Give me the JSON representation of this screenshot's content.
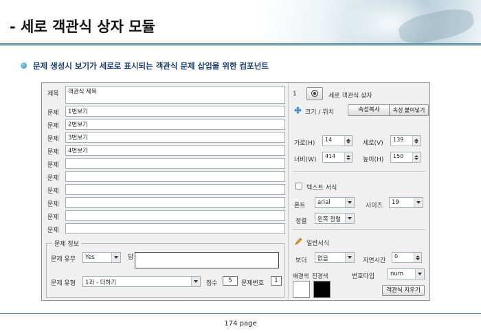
{
  "slide": {
    "title": "- 세로 객관식 상자 모듈",
    "subtitle": "문제 생성시 보기가 세로로 표시되는 객관식 문제 삽입을 위한 컴포넌트",
    "page": "174 page"
  },
  "form": {
    "title_label": "제목",
    "title_value": "객관식 제목",
    "question_label": "문제",
    "rows": [
      {
        "value": "1번보기"
      },
      {
        "value": "2번보기"
      },
      {
        "value": "3번보기"
      },
      {
        "value": "4번보기"
      },
      {
        "value": ""
      },
      {
        "value": ""
      },
      {
        "value": ""
      },
      {
        "value": ""
      },
      {
        "value": ""
      },
      {
        "value": ""
      }
    ],
    "info_legend": "문제 정보",
    "presence_label": "문제 유무",
    "presence_value": "Yes",
    "answer_label": "답",
    "type_label": "문제 유형",
    "type_value": "1과 - 더하기",
    "score_label": "점수",
    "score_value": "5",
    "qnum_label": "문제번호",
    "qnum_value": "1"
  },
  "props": {
    "index": "1",
    "module_name": "세로 객관식 상자",
    "size_pos_label": "크기 / 위치",
    "copy_btn": "속성복사",
    "paste_btn": "속성 붙여넣기",
    "x_label": "가로(H)",
    "x_value": "14",
    "y_label": "세로(V)",
    "y_value": "139",
    "w_label": "너비(W)",
    "w_value": "414",
    "h_label": "높이(H)",
    "h_value": "150",
    "text_format_label": "텍스트 서식",
    "font_label": "폰트",
    "font_value": "arial",
    "size_label": "사이즈",
    "size_value": "19",
    "align_label": "정렬",
    "align_value": "왼쪽 정렬",
    "general_label": "일반서식",
    "border_label": "보더",
    "border_value": "없음",
    "delay_label": "지연시간",
    "delay_value": "0",
    "bg_label": "배경색",
    "fg_label": "전경색",
    "numtype_label": "번호타입",
    "numtype_value": "num",
    "clear_btn": "객관식 지우기",
    "bg_color": "#ffffff",
    "fg_color": "#000000"
  }
}
